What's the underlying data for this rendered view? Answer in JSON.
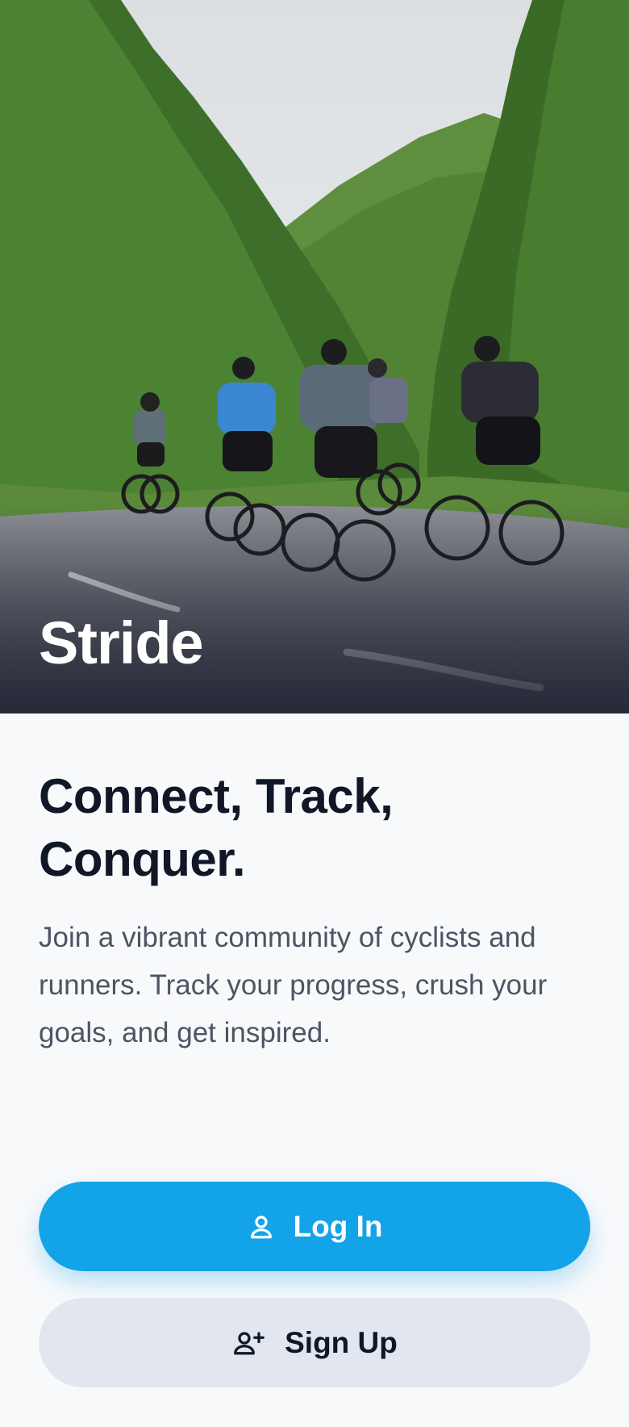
{
  "hero": {
    "app_name": "Stride",
    "image_icon": "cyclists-on-road-photo"
  },
  "intro": {
    "headline": "Connect, Track, Conquer.",
    "description": "Join a vibrant community of cyclists and runners. Track your progress, crush your goals, and get inspired."
  },
  "actions": {
    "login": {
      "label": "Log In",
      "icon": "user-icon"
    },
    "signup": {
      "label": "Sign Up",
      "icon": "user-plus-icon"
    }
  },
  "colors": {
    "primary": "#13a3e8",
    "secondary_button": "#e2e7ef",
    "background": "#f8f9fb",
    "heading": "#101828",
    "body_text": "#4b5563"
  }
}
